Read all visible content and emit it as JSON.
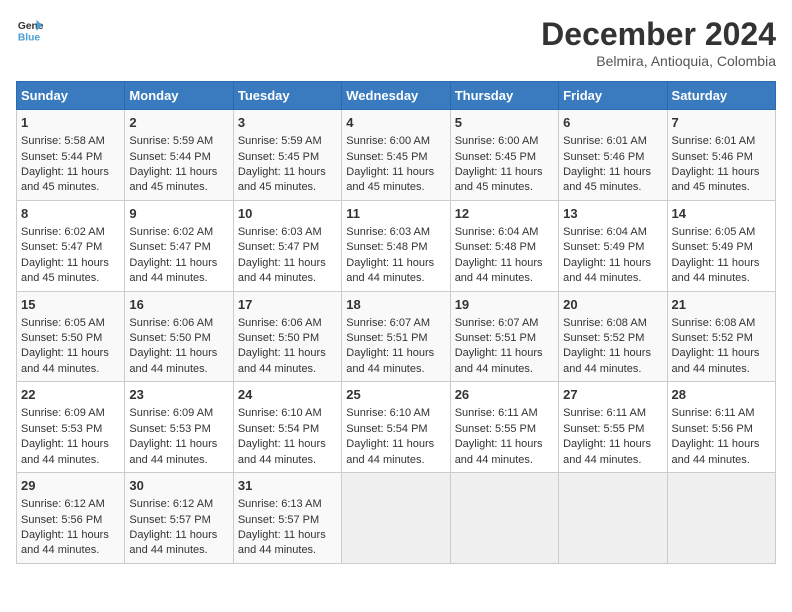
{
  "logo": {
    "line1": "General",
    "line2": "Blue"
  },
  "title": "December 2024",
  "subtitle": "Belmira, Antioquia, Colombia",
  "days_of_week": [
    "Sunday",
    "Monday",
    "Tuesday",
    "Wednesday",
    "Thursday",
    "Friday",
    "Saturday"
  ],
  "weeks": [
    [
      {
        "day": 1,
        "lines": [
          "Sunrise: 5:58 AM",
          "Sunset: 5:44 PM",
          "Daylight: 11 hours",
          "and 45 minutes."
        ]
      },
      {
        "day": 2,
        "lines": [
          "Sunrise: 5:59 AM",
          "Sunset: 5:44 PM",
          "Daylight: 11 hours",
          "and 45 minutes."
        ]
      },
      {
        "day": 3,
        "lines": [
          "Sunrise: 5:59 AM",
          "Sunset: 5:45 PM",
          "Daylight: 11 hours",
          "and 45 minutes."
        ]
      },
      {
        "day": 4,
        "lines": [
          "Sunrise: 6:00 AM",
          "Sunset: 5:45 PM",
          "Daylight: 11 hours",
          "and 45 minutes."
        ]
      },
      {
        "day": 5,
        "lines": [
          "Sunrise: 6:00 AM",
          "Sunset: 5:45 PM",
          "Daylight: 11 hours",
          "and 45 minutes."
        ]
      },
      {
        "day": 6,
        "lines": [
          "Sunrise: 6:01 AM",
          "Sunset: 5:46 PM",
          "Daylight: 11 hours",
          "and 45 minutes."
        ]
      },
      {
        "day": 7,
        "lines": [
          "Sunrise: 6:01 AM",
          "Sunset: 5:46 PM",
          "Daylight: 11 hours",
          "and 45 minutes."
        ]
      }
    ],
    [
      {
        "day": 8,
        "lines": [
          "Sunrise: 6:02 AM",
          "Sunset: 5:47 PM",
          "Daylight: 11 hours",
          "and 45 minutes."
        ]
      },
      {
        "day": 9,
        "lines": [
          "Sunrise: 6:02 AM",
          "Sunset: 5:47 PM",
          "Daylight: 11 hours",
          "and 44 minutes."
        ]
      },
      {
        "day": 10,
        "lines": [
          "Sunrise: 6:03 AM",
          "Sunset: 5:47 PM",
          "Daylight: 11 hours",
          "and 44 minutes."
        ]
      },
      {
        "day": 11,
        "lines": [
          "Sunrise: 6:03 AM",
          "Sunset: 5:48 PM",
          "Daylight: 11 hours",
          "and 44 minutes."
        ]
      },
      {
        "day": 12,
        "lines": [
          "Sunrise: 6:04 AM",
          "Sunset: 5:48 PM",
          "Daylight: 11 hours",
          "and 44 minutes."
        ]
      },
      {
        "day": 13,
        "lines": [
          "Sunrise: 6:04 AM",
          "Sunset: 5:49 PM",
          "Daylight: 11 hours",
          "and 44 minutes."
        ]
      },
      {
        "day": 14,
        "lines": [
          "Sunrise: 6:05 AM",
          "Sunset: 5:49 PM",
          "Daylight: 11 hours",
          "and 44 minutes."
        ]
      }
    ],
    [
      {
        "day": 15,
        "lines": [
          "Sunrise: 6:05 AM",
          "Sunset: 5:50 PM",
          "Daylight: 11 hours",
          "and 44 minutes."
        ]
      },
      {
        "day": 16,
        "lines": [
          "Sunrise: 6:06 AM",
          "Sunset: 5:50 PM",
          "Daylight: 11 hours",
          "and 44 minutes."
        ]
      },
      {
        "day": 17,
        "lines": [
          "Sunrise: 6:06 AM",
          "Sunset: 5:50 PM",
          "Daylight: 11 hours",
          "and 44 minutes."
        ]
      },
      {
        "day": 18,
        "lines": [
          "Sunrise: 6:07 AM",
          "Sunset: 5:51 PM",
          "Daylight: 11 hours",
          "and 44 minutes."
        ]
      },
      {
        "day": 19,
        "lines": [
          "Sunrise: 6:07 AM",
          "Sunset: 5:51 PM",
          "Daylight: 11 hours",
          "and 44 minutes."
        ]
      },
      {
        "day": 20,
        "lines": [
          "Sunrise: 6:08 AM",
          "Sunset: 5:52 PM",
          "Daylight: 11 hours",
          "and 44 minutes."
        ]
      },
      {
        "day": 21,
        "lines": [
          "Sunrise: 6:08 AM",
          "Sunset: 5:52 PM",
          "Daylight: 11 hours",
          "and 44 minutes."
        ]
      }
    ],
    [
      {
        "day": 22,
        "lines": [
          "Sunrise: 6:09 AM",
          "Sunset: 5:53 PM",
          "Daylight: 11 hours",
          "and 44 minutes."
        ]
      },
      {
        "day": 23,
        "lines": [
          "Sunrise: 6:09 AM",
          "Sunset: 5:53 PM",
          "Daylight: 11 hours",
          "and 44 minutes."
        ]
      },
      {
        "day": 24,
        "lines": [
          "Sunrise: 6:10 AM",
          "Sunset: 5:54 PM",
          "Daylight: 11 hours",
          "and 44 minutes."
        ]
      },
      {
        "day": 25,
        "lines": [
          "Sunrise: 6:10 AM",
          "Sunset: 5:54 PM",
          "Daylight: 11 hours",
          "and 44 minutes."
        ]
      },
      {
        "day": 26,
        "lines": [
          "Sunrise: 6:11 AM",
          "Sunset: 5:55 PM",
          "Daylight: 11 hours",
          "and 44 minutes."
        ]
      },
      {
        "day": 27,
        "lines": [
          "Sunrise: 6:11 AM",
          "Sunset: 5:55 PM",
          "Daylight: 11 hours",
          "and 44 minutes."
        ]
      },
      {
        "day": 28,
        "lines": [
          "Sunrise: 6:11 AM",
          "Sunset: 5:56 PM",
          "Daylight: 11 hours",
          "and 44 minutes."
        ]
      }
    ],
    [
      {
        "day": 29,
        "lines": [
          "Sunrise: 6:12 AM",
          "Sunset: 5:56 PM",
          "Daylight: 11 hours",
          "and 44 minutes."
        ]
      },
      {
        "day": 30,
        "lines": [
          "Sunrise: 6:12 AM",
          "Sunset: 5:57 PM",
          "Daylight: 11 hours",
          "and 44 minutes."
        ]
      },
      {
        "day": 31,
        "lines": [
          "Sunrise: 6:13 AM",
          "Sunset: 5:57 PM",
          "Daylight: 11 hours",
          "and 44 minutes."
        ]
      },
      null,
      null,
      null,
      null
    ]
  ]
}
